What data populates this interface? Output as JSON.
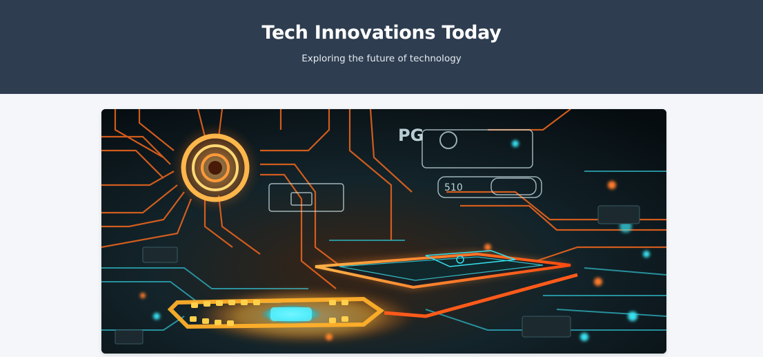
{
  "header": {
    "title": "Tech Innovations Today",
    "tagline": "Exploring the future of technology"
  },
  "hero": {
    "image_subject": "glowing circuit board with processor chip",
    "chip_label": "PG",
    "panel_readout": "510"
  },
  "colors": {
    "header_bg": "#2e3d50",
    "page_bg": "#f4f6f9",
    "trace_orange": "#ff7a2a",
    "trace_cyan": "#38e1f0"
  }
}
